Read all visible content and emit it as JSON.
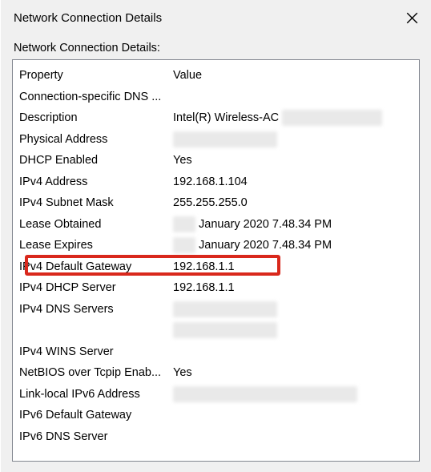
{
  "window": {
    "title": "Network Connection Details",
    "subtitle": "Network Connection Details:"
  },
  "headers": {
    "property": "Property",
    "value": "Value"
  },
  "rows": [
    {
      "prop": "Connection-specific DNS ...",
      "val": "",
      "blurVal": false
    },
    {
      "prop": "Description",
      "val": "Intel(R) Wireless-AC",
      "blurAfter": 125
    },
    {
      "prop": "Physical Address",
      "val": "",
      "blurAfter": 130
    },
    {
      "prop": "DHCP Enabled",
      "val": "Yes"
    },
    {
      "prop": "IPv4 Address",
      "val": "192.168.1.104"
    },
    {
      "prop": "IPv4 Subnet Mask",
      "val": "255.255.255.0"
    },
    {
      "prop": "Lease Obtained",
      "val": "January 2020 7.48.34 PM",
      "blurBefore": true
    },
    {
      "prop": "Lease Expires",
      "val": "January 2020 7.48.34 PM",
      "blurBefore": true
    },
    {
      "prop": "IPv4 Default Gateway",
      "val": "192.168.1.1",
      "highlight": true
    },
    {
      "prop": "IPv4 DHCP Server",
      "val": "192.168.1.1"
    },
    {
      "prop": "IPv4 DNS Servers",
      "val": "",
      "blurAfter": 130
    },
    {
      "prop": "",
      "val": "",
      "blurAfter": 130
    },
    {
      "prop": "IPv4 WINS Server",
      "val": ""
    },
    {
      "prop": "NetBIOS over Tcpip Enab...",
      "val": "Yes"
    },
    {
      "prop": "Link-local IPv6 Address",
      "val": "",
      "blurAfter": 230
    },
    {
      "prop": "IPv6 Default Gateway",
      "val": ""
    },
    {
      "prop": "IPv6 DNS Server",
      "val": ""
    }
  ]
}
